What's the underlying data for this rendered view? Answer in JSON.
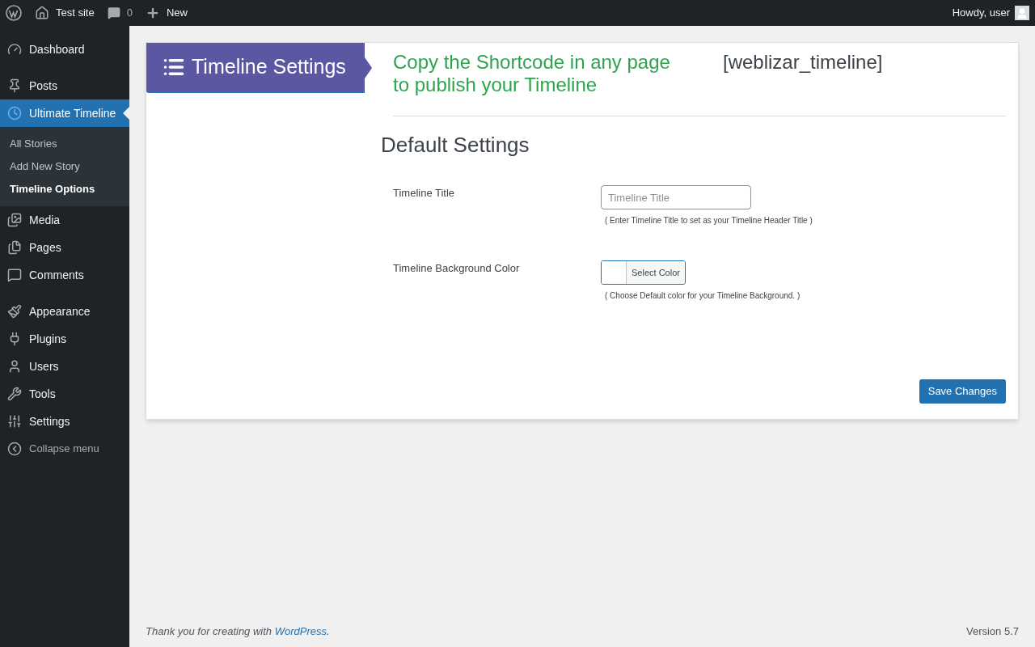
{
  "admin_bar": {
    "site": "Test site",
    "comments": "0",
    "new": "New",
    "greeting": "Howdy, user"
  },
  "sidebar": {
    "groups": [
      [
        {
          "label": "Dashboard",
          "selected": false
        }
      ],
      [
        {
          "label": "Posts",
          "selected": false
        },
        {
          "label": "Ultimate Timeline",
          "selected": true,
          "children": [
            {
              "label": "All Stories",
              "selected": false
            },
            {
              "label": "Add New Story",
              "selected": false
            },
            {
              "label": "Timeline Options",
              "selected": true
            }
          ]
        },
        {
          "label": "Media",
          "selected": false
        },
        {
          "label": "Pages",
          "selected": false
        },
        {
          "label": "Comments",
          "selected": false
        }
      ],
      [
        {
          "label": "Appearance",
          "selected": false
        },
        {
          "label": "Plugins",
          "selected": false
        },
        {
          "label": "Users",
          "selected": false
        },
        {
          "label": "Tools",
          "selected": false
        },
        {
          "label": "Settings",
          "selected": false
        }
      ]
    ],
    "collapse": "Collapse menu"
  },
  "panel": {
    "title": "Timeline Settings",
    "shortcode_hint": "Copy the Shortcode in any page to publish your Timeline",
    "shortcode": "[weblizar_timeline]",
    "section": "Default Settings",
    "fields": [
      {
        "kind": "text",
        "label": "Timeline Title",
        "placeholder": "Timeline Title",
        "help": "( Enter Timeline Title to set as your Timeline Header Title )"
      },
      {
        "kind": "color",
        "label": "Timeline Background Color",
        "button": "Select Color",
        "help": "( Choose Default color for your Timeline Background. )"
      }
    ],
    "save": "Save Changes"
  },
  "footer": {
    "thanks": "Thank you for creating with ",
    "link": "WordPress",
    "after": ".",
    "version": "Version 5.7"
  }
}
